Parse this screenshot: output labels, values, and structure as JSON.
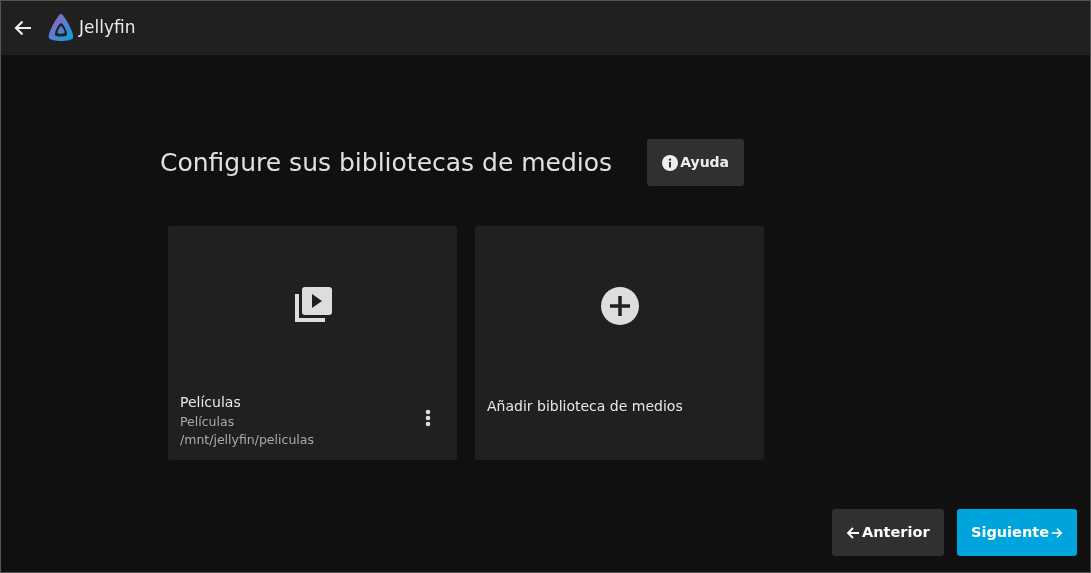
{
  "header": {
    "app_name": "Jellyfin"
  },
  "title": "Configure sus bibliotecas de medios",
  "help_button": "Ayuda",
  "libraries": [
    {
      "kind": "library",
      "name": "Películas",
      "type": "Películas",
      "path": "/mnt/jellyfin/peliculas"
    },
    {
      "kind": "add",
      "name": "Añadir biblioteca de medios"
    }
  ],
  "buttons": [
    {
      "label": "Anterior",
      "kind": "back"
    },
    {
      "label": "Siguiente",
      "kind": "next"
    }
  ]
}
